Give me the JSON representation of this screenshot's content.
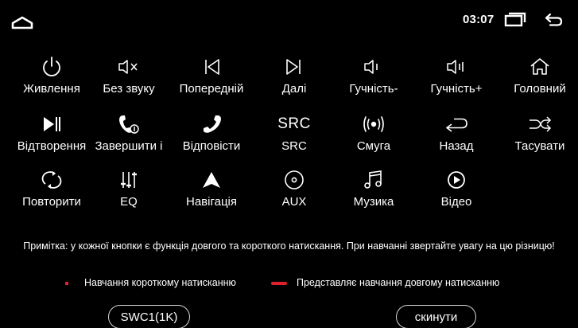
{
  "status_bar": {
    "time": "03:07",
    "icons": [
      "home-icon",
      "recent-apps-icon",
      "back-icon"
    ]
  },
  "functions": [
    {
      "label": "Живлення",
      "icon": "power-icon"
    },
    {
      "label": "Без звуку",
      "icon": "mute-icon"
    },
    {
      "label": "Попередній",
      "icon": "previous-track-icon"
    },
    {
      "label": "Далі",
      "icon": "next-track-icon"
    },
    {
      "label": "Гучність-",
      "icon": "volume-down-icon"
    },
    {
      "label": "Гучність+",
      "icon": "volume-up-icon"
    },
    {
      "label": "Головний",
      "icon": "home-icon"
    },
    {
      "label": "Відтворення",
      "icon": "play-pause-icon"
    },
    {
      "label": "Завершити і",
      "icon": "hang-up-icon"
    },
    {
      "label": "Відповісти",
      "icon": "answer-call-icon"
    },
    {
      "label": "SRC",
      "icon": "src-icon",
      "icon_text": "SRC"
    },
    {
      "label": "Смуга",
      "icon": "radio-band-icon"
    },
    {
      "label": "Назад",
      "icon": "back-icon"
    },
    {
      "label": "Тасувати",
      "icon": "shuffle-icon"
    },
    {
      "label": "Повторити",
      "icon": "repeat-icon"
    },
    {
      "label": "EQ",
      "icon": "equalizer-icon"
    },
    {
      "label": "Навігація",
      "icon": "navigation-icon"
    },
    {
      "label": "AUX",
      "icon": "aux-icon"
    },
    {
      "label": "Музика",
      "icon": "music-icon"
    },
    {
      "label": "Відео",
      "icon": "video-icon"
    }
  ],
  "note": "Примітка: у кожної кнопки є функція довгого та короткого натискання. При навчанні звертайте увагу на цю різницю!",
  "legend": {
    "short_label": "Навчання короткому натисканню",
    "long_label": "Представляє навчання довгому натисканню",
    "marker_color": "#e0202a"
  },
  "buttons": {
    "swc": "SWC1(1K)",
    "reset": "скинути"
  }
}
